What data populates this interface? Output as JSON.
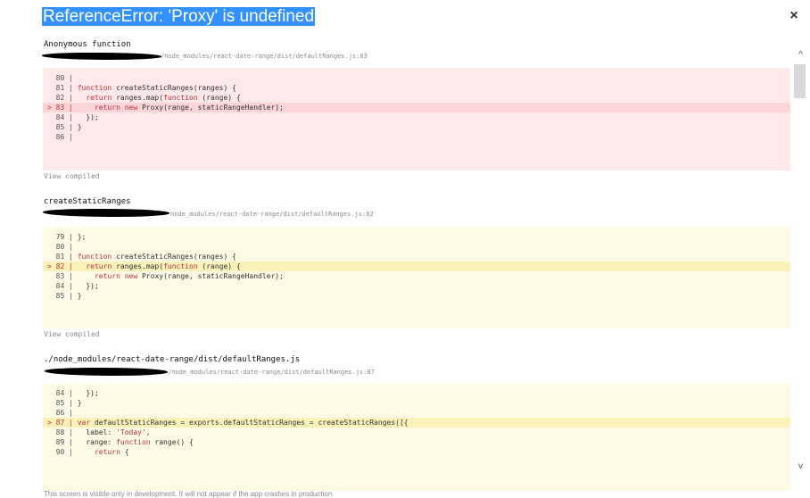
{
  "header": {
    "title": "ReferenceError: 'Proxy' is undefined",
    "close_label": "×"
  },
  "frames": [
    {
      "function": "Anonymous function",
      "file": "/node_modules/react-date-range/dist/defaultRanges.js:83",
      "lines": [
        {
          "marker": "  ",
          "num": "80",
          "code": ""
        },
        {
          "marker": "  ",
          "num": "81",
          "code": "function createStaticRanges(ranges) {"
        },
        {
          "marker": "  ",
          "num": "82",
          "code": "  return ranges.map(function (range) {"
        },
        {
          "marker": "> ",
          "num": "83",
          "code": "    return new Proxy(range, staticRangeHandler);"
        },
        {
          "marker": "  ",
          "num": "84",
          "code": "  });"
        },
        {
          "marker": "  ",
          "num": "85",
          "code": "}"
        },
        {
          "marker": "  ",
          "num": "86",
          "code": ""
        }
      ],
      "view_compiled": "View compiled"
    },
    {
      "function": "createStaticRanges",
      "file": "node_modules/react-date-range/dist/defaultRanges.js:82",
      "lines": [
        {
          "marker": "  ",
          "num": "79",
          "code": "};"
        },
        {
          "marker": "  ",
          "num": "80",
          "code": ""
        },
        {
          "marker": "  ",
          "num": "81",
          "code": "function createStaticRanges(ranges) {"
        },
        {
          "marker": "> ",
          "num": "82",
          "code": "  return ranges.map(function (range) {"
        },
        {
          "marker": "  ",
          "num": "83",
          "code": "    return new Proxy(range, staticRangeHandler);"
        },
        {
          "marker": "  ",
          "num": "84",
          "code": "  });"
        },
        {
          "marker": "  ",
          "num": "85",
          "code": "}"
        }
      ],
      "view_compiled": "View compiled"
    },
    {
      "function": "./node_modules/react-date-range/dist/defaultRanges.js",
      "file": "/node_modules/react-date-range/dist/defaultRanges.js:87",
      "lines": [
        {
          "marker": "  ",
          "num": "84",
          "code": "  });"
        },
        {
          "marker": "  ",
          "num": "85",
          "code": "}"
        },
        {
          "marker": "  ",
          "num": "86",
          "code": ""
        },
        {
          "marker": "> ",
          "num": "87",
          "code": "var defaultStaticRanges = exports.defaultStaticRanges = createStaticRanges([{"
        },
        {
          "marker": "  ",
          "num": "88",
          "code": "  label: 'Today',"
        },
        {
          "marker": "  ",
          "num": "89",
          "code": "  range: function range() {"
        },
        {
          "marker": "  ",
          "num": "90",
          "code": "    return {"
        }
      ]
    }
  ],
  "scrollbar": {
    "up": "^",
    "down": "v"
  },
  "footer": "This screen is visible only in development. It will not appear if the app crashes in production."
}
